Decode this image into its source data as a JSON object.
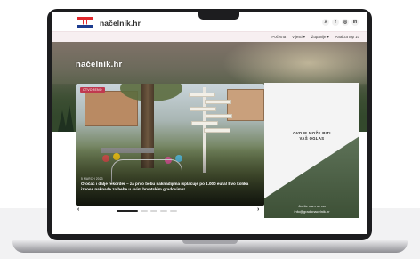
{
  "site": {
    "logo_text": "načelnik.hr",
    "hero_logo_text": "načelnik.hr",
    "social_icons": [
      "search-icon",
      "facebook-icon",
      "instagram-icon",
      "linkedin-icon"
    ],
    "social_glyphs": [
      "⌕",
      "f",
      "◎",
      "in"
    ]
  },
  "nav": {
    "items": [
      "Početna",
      "Vijesti ▾",
      "Županije ▾",
      "Analiza top 10"
    ]
  },
  "slider": {
    "category": "OTVORENO",
    "date": "5 MARCH 2023",
    "headline": "Otočac i dalje rekorder – za prvo bebu naknadijima isplaćuje po 1.000 eura! Evo kolika izvose naknade za bebe u svim hrvatskim gradovima!",
    "prev_glyph": "‹",
    "next_glyph": "›",
    "slide_count": 5,
    "active_index": 0
  },
  "ad": {
    "line1": "OVDJE MOŽE BITI",
    "line2": "VAŠ OGLAS",
    "contact_line1": "Javite nam se na",
    "contact_line2": "info@gradonacelnik.hr"
  },
  "colors": {
    "brand_red": "#c0394f",
    "nav_bg": "#f7eff1"
  }
}
